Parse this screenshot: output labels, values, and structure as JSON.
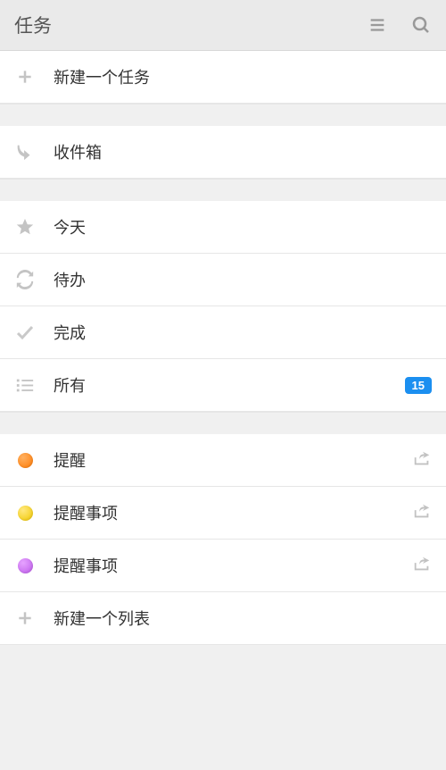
{
  "header": {
    "title": "任务"
  },
  "new_task_label": "新建一个任务",
  "inbox_label": "收件箱",
  "filters": {
    "today": "今天",
    "pending": "待办",
    "done": "完成",
    "all": "所有",
    "all_count": "15"
  },
  "lists": [
    {
      "label": "提醒",
      "color": "orange"
    },
    {
      "label": "提醒事项",
      "color": "yellow"
    },
    {
      "label": "提醒事项",
      "color": "purple"
    }
  ],
  "new_list_label": "新建一个列表"
}
